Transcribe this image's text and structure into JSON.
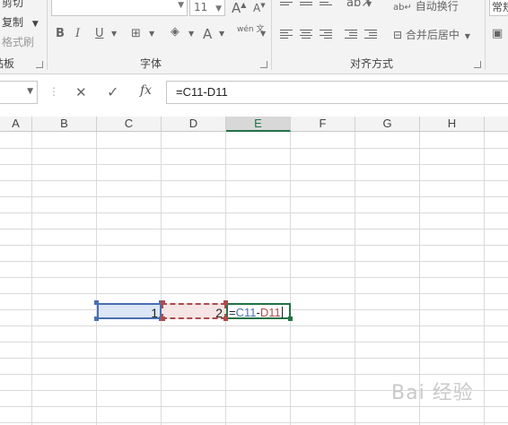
{
  "ribbon": {
    "clipboard": {
      "cut": "剪切",
      "copy": "复制",
      "format_painter": "格式刷",
      "group_label": "贴板"
    },
    "font": {
      "font_name": "",
      "font_size": "11",
      "grow_icon": "A",
      "shrink_icon": "A",
      "bold": "B",
      "italic": "I",
      "underline": "U",
      "font_color_icon": "A",
      "phonetic_icon": "wén 文",
      "group_label": "字体"
    },
    "alignment": {
      "wrap_text": "自动换行",
      "merge_center": "合并后居中",
      "group_label": "对齐方式"
    },
    "number": {
      "format": "常规"
    }
  },
  "formula_bar": {
    "cancel_icon": "✕",
    "enter_icon": "✓",
    "fx": "fx",
    "formula": "=C11-D11"
  },
  "columns": [
    "A",
    "B",
    "C",
    "D",
    "E",
    "F",
    "G",
    "H"
  ],
  "active_column": "E",
  "cells": {
    "C11": "1",
    "D11": "2",
    "E11_prefix": "=",
    "E11_ref1": "C11",
    "E11_op": "-",
    "E11_ref2": "D11"
  },
  "colors": {
    "accent": "#217346",
    "ref1": "#4a70b0",
    "ref2": "#b04a4a"
  },
  "watermark": "Bai 经验"
}
